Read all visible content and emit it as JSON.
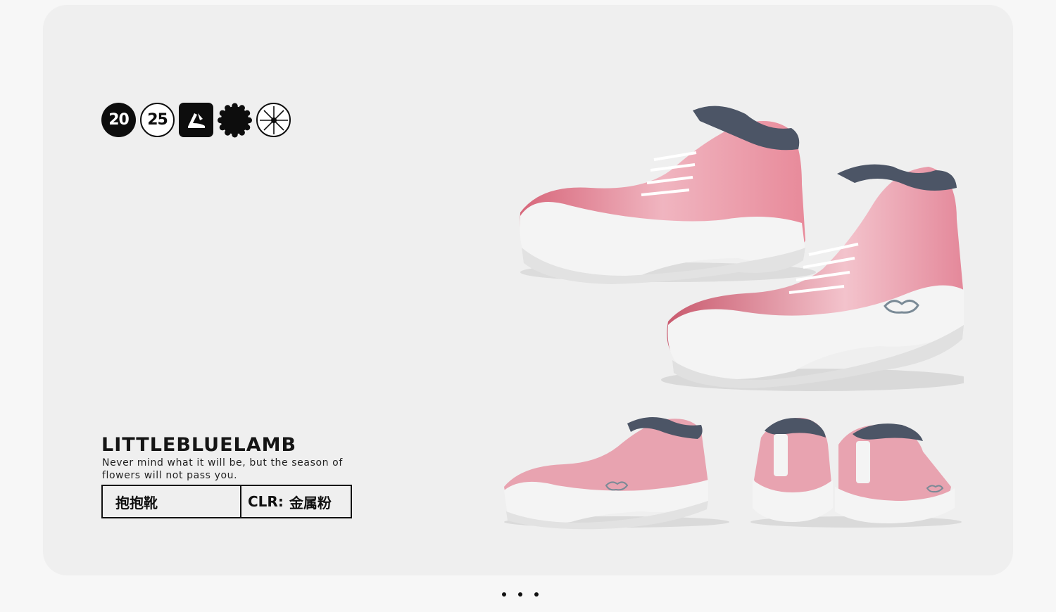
{
  "badges": [
    "20",
    "25"
  ],
  "brand": "LITTLEBLUELAMB",
  "tagline": "Never mind what it will be, but the season of flowers will not pass you.",
  "product": {
    "name": "抱抱靴",
    "color_label": "CLR:",
    "color_value": "金属粉"
  },
  "carousel": {
    "pages": 3
  },
  "colors": {
    "pink": "#e07283",
    "pink_light": "#f2bcc6",
    "white": "#f4f4f4",
    "navy": "#4c5566",
    "background": "#efefef"
  }
}
